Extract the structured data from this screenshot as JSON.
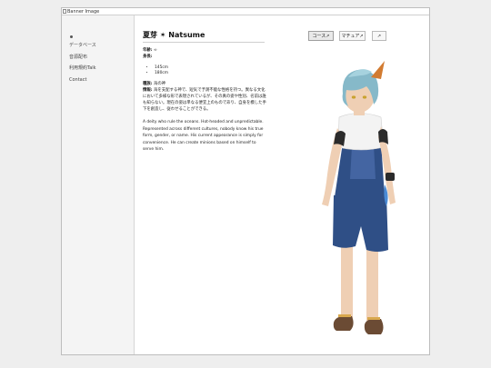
{
  "banner": {
    "alt_text": "Banner Image"
  },
  "sidebar": {
    "items": [
      {
        "label": "データベース"
      },
      {
        "label": "音源配布"
      },
      {
        "label": "利用規約Talk"
      },
      {
        "label": "Contact"
      }
    ]
  },
  "character": {
    "title": "夏芽 ✶ Natsume",
    "age_label": "年齢:",
    "age_value": "∞",
    "height_label": "身長:",
    "heights": [
      "145cm",
      "180cm"
    ],
    "species_label": "種族:",
    "species_value": "海の神",
    "info_label": "情報:",
    "info_value": "海を支配する神で、短気で予測不能な性格を持つ。異なる文化において多様な形で表現されているが、その真の姿や性別、名前は誰も知らない。現在の姿は単なる便宜上のものであり、自身を模した手下を創造し、従わせることができる。",
    "description_en": "A deity who rule the oceans. Hot-headed and unpredictable. Represented across different cultures, nobody know his true form, gender, or name. His current appearance is simply for convenience. He can create minions based on himself to serve him."
  },
  "buttons": {
    "costume1": "コース↗",
    "costume2": "マチュア↗",
    "costume3": "↗"
  },
  "colors": {
    "hair": "#86b9c9",
    "overalls": "#2f4f86",
    "skin": "#efcfb4",
    "accent": "#d27b31"
  }
}
